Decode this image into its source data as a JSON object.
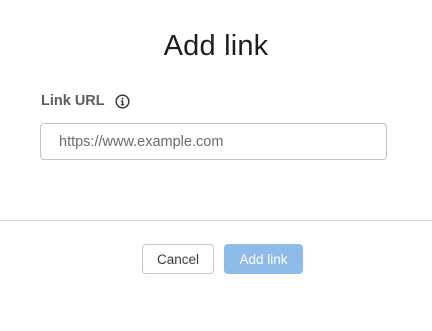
{
  "dialog": {
    "title": "Add link",
    "field": {
      "label": "Link URL",
      "info_icon": "info-circle-icon",
      "value": "",
      "placeholder": "https://www.example.com"
    },
    "buttons": {
      "cancel_label": "Cancel",
      "submit_label": "Add link",
      "submit_state": "disabled"
    },
    "colors": {
      "primary_disabled": "#8fbbe8",
      "title_text": "#1e1e1e",
      "label_text": "#5c5c5c",
      "divider": "#d6d6d6"
    }
  }
}
